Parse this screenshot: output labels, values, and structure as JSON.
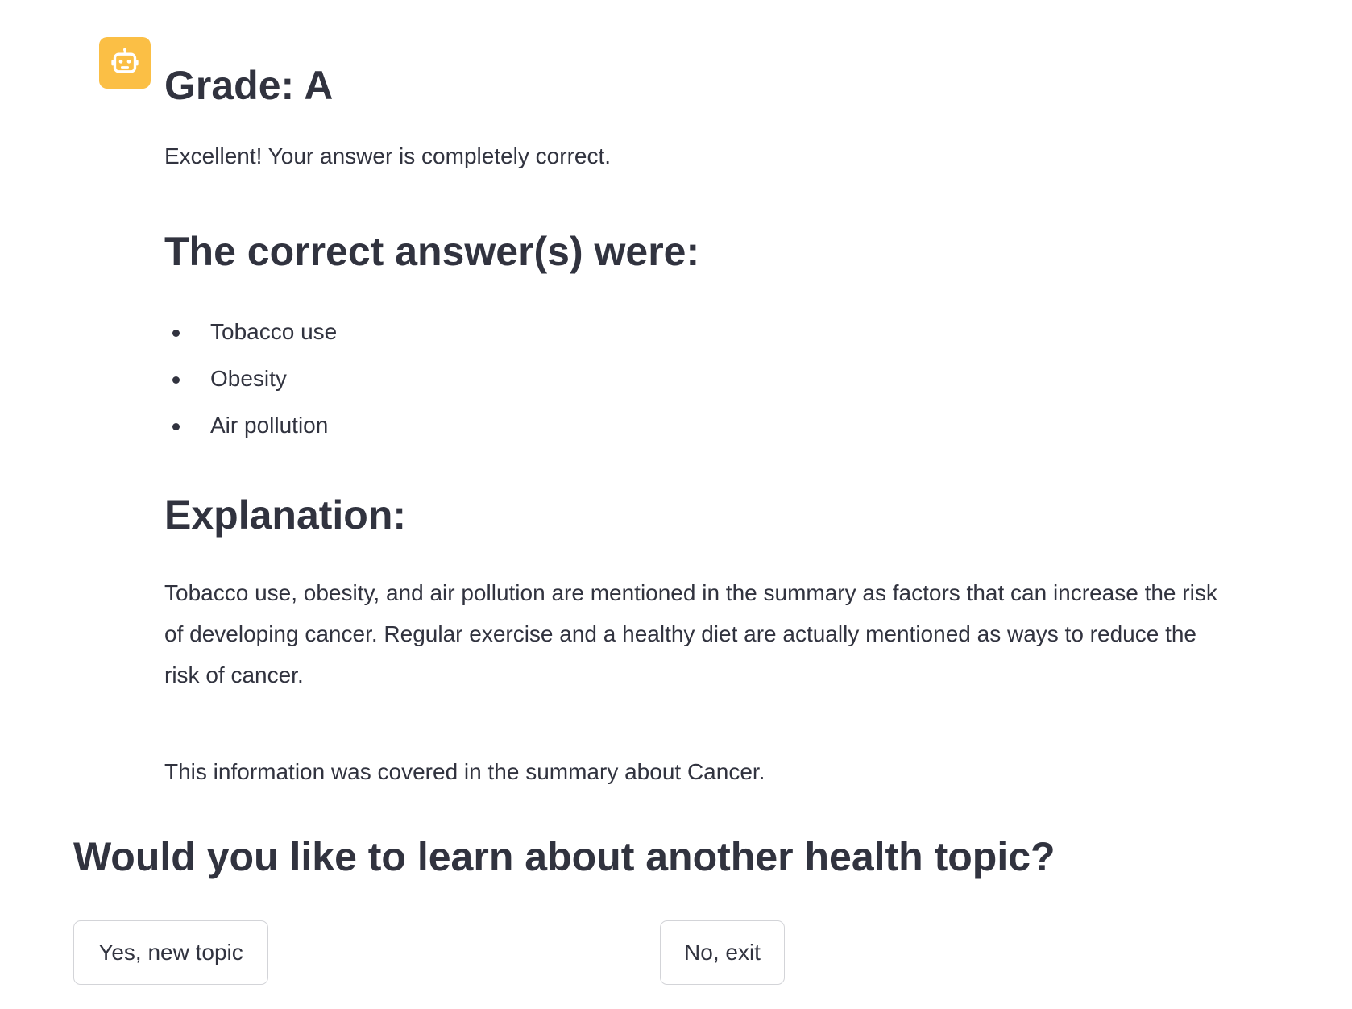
{
  "message": {
    "avatar_icon": "robot-icon",
    "avatar_color": "#fbbf45",
    "grade_heading": "Grade: A",
    "feedback": "Excellent! Your answer is completely correct.",
    "answers_heading": "The correct answer(s) were:",
    "answers": [
      "Tobacco use",
      "Obesity",
      "Air pollution"
    ],
    "explanation_heading": "Explanation:",
    "explanation": "Tobacco use, obesity, and air pollution are mentioned in the summary as factors that can increase the risk of developing cancer. Regular exercise and a healthy diet are actually mentioned as ways to reduce the risk of cancer.",
    "coverage": "This information was covered in the summary about Cancer."
  },
  "followup": {
    "question": "Would you like to learn about another health topic?",
    "yes_label": "Yes, new topic",
    "no_label": "No, exit"
  },
  "colors": {
    "text": "#31333f",
    "button_border": "#d3d4d8"
  }
}
